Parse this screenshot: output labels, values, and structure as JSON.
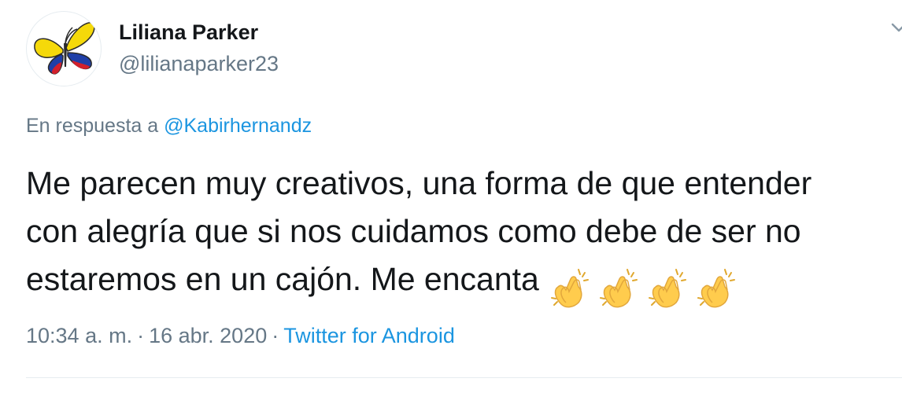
{
  "author": {
    "display_name": "Liliana Parker",
    "handle": "@lilianaparker23",
    "avatar_icon": "butterfly-colombia-flag-icon"
  },
  "reply": {
    "prefix": "En respuesta a",
    "mention": "@Kabirhernandz"
  },
  "tweet": {
    "lines": [
      "Me parecen muy creativos, una forma de que entender",
      "con alegría que si nos cuidamos como debe de ser no",
      "estaremos en un cajón. Me encanta"
    ],
    "emoji_icon": "clapping-hands-icon",
    "emoji_count": 4
  },
  "meta": {
    "time": "10:34 a. m.",
    "date": "16 abr. 2020",
    "separator": "·",
    "source": "Twitter for Android"
  },
  "colors": {
    "text": "#14171a",
    "secondary": "#657786",
    "link": "#1b95e0",
    "divider": "#e6ecf0"
  }
}
